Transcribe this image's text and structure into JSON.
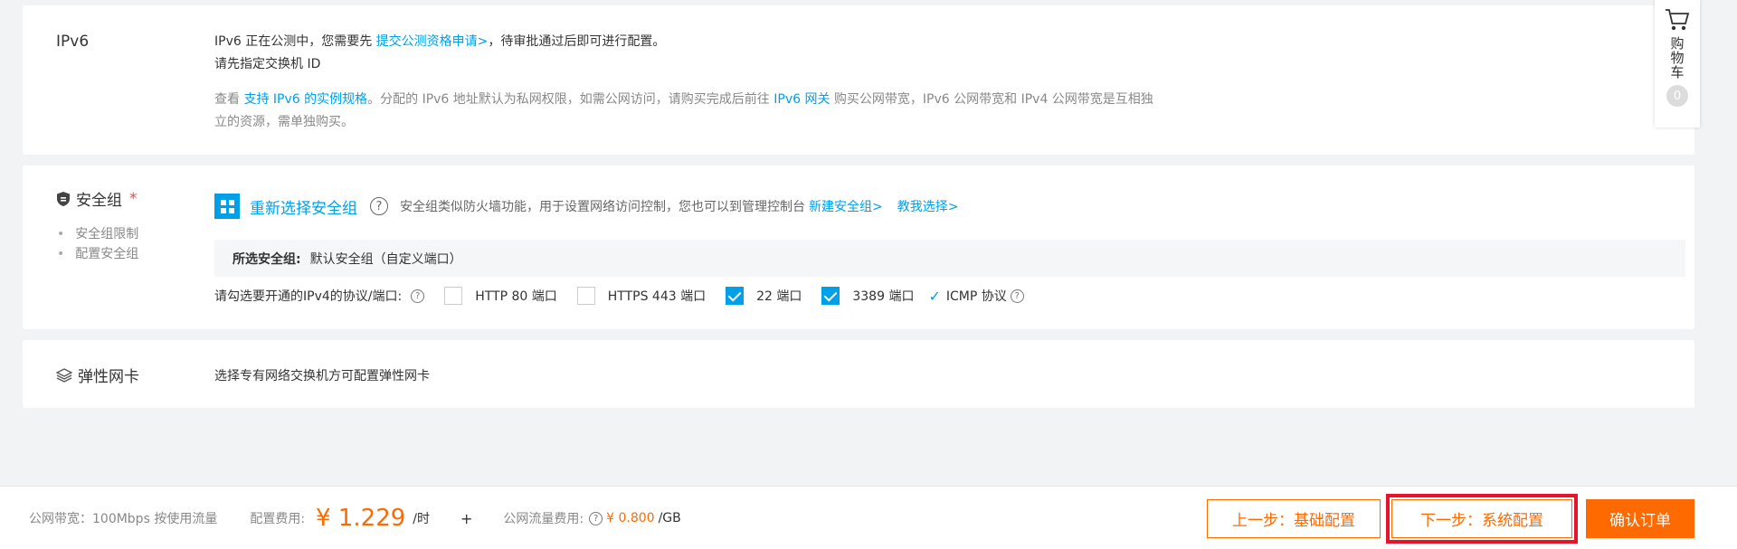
{
  "ipv6": {
    "label": "IPv6",
    "line1_pre": "IPv6 正在公测中，您需要先 ",
    "line1_link": "提交公测资格申请>",
    "line1_post": "，待审批通过后即可进行配置。",
    "line2": "请先指定交换机 ID",
    "line3_pre": "查看 ",
    "line3_link1": "支持 IPv6 的实例规格",
    "line3_mid": "。分配的 IPv6 地址默认为私网权限，如需公网访问，请购买完成后前往 ",
    "line3_link2": "IPv6 网关",
    "line3_post": " 购买公网带宽，IPv6 公网带宽和 IPv4 公网带宽是互相独立的资源，需单独购买。"
  },
  "security": {
    "label": "安全组",
    "required": "*",
    "side_items": [
      "安全组限制",
      "配置安全组"
    ],
    "reselect_label": "重新选择安全组",
    "help_glyph": "?",
    "description": "安全组类似防火墙功能，用于设置网络访问控制，您也可以到管理控制台",
    "create_link": "新建安全组>",
    "teach_link": "教我选择>",
    "selected_key": "所选安全组:",
    "selected_value": "默认安全组（自定义端口）",
    "ports_label": "请勾选要开通的IPv4的协议/端口:",
    "ports": [
      {
        "label": "HTTP 80 端口",
        "checked": false
      },
      {
        "label": "HTTPS 443 端口",
        "checked": false
      },
      {
        "label": "22 端口",
        "checked": true
      },
      {
        "label": "3389 端口",
        "checked": true
      }
    ],
    "icmp_label": "ICMP 协议"
  },
  "eni": {
    "label": "弹性网卡",
    "text": "选择专有网络交换机方可配置弹性网卡"
  },
  "cart": {
    "label": "购物车",
    "count": "0"
  },
  "footer": {
    "bandwidth": "公网带宽：100Mbps 按使用流量",
    "fee_label": "配置费用:",
    "price": "¥ 1.229",
    "price_unit": "/时",
    "plus": "+",
    "traffic_label": "公网流量费用:",
    "traffic_price": "¥ 0.800",
    "traffic_unit": "/GB",
    "prev_button": "上一步：基础配置",
    "next_button": "下一步：系统配置",
    "confirm_button": "确认订单"
  },
  "colors": {
    "accent": "#00a0e9",
    "orange": "#ff6a00",
    "highlight": "#e5132c"
  }
}
